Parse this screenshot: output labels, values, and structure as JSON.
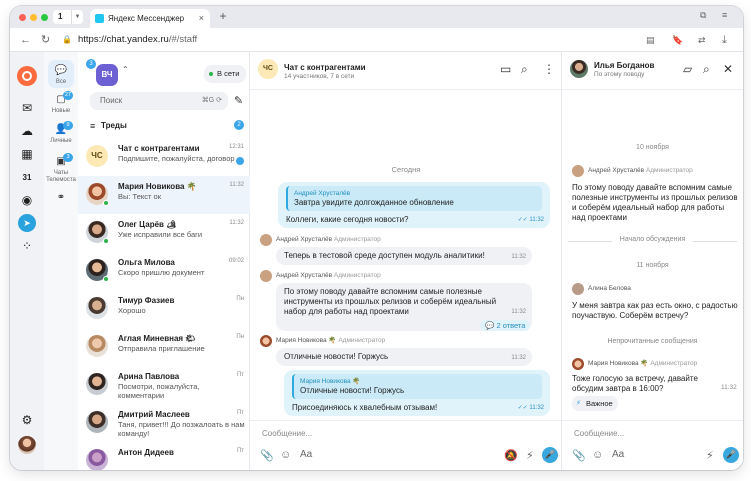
{
  "browser": {
    "tab_count": "1",
    "tab_title": "Яндекс Мессенджер",
    "url_host": "https://chat.yandex.ru",
    "url_path": "/#/staff"
  },
  "categories": [
    {
      "label": "Все",
      "badge": "27"
    },
    {
      "label": "Новые",
      "badge": ""
    },
    {
      "label": "Личные",
      "badge": "9"
    },
    {
      "label": "Чаты Телемоста",
      "badge": "3"
    }
  ],
  "workspace": {
    "initials": "ВЧ",
    "badge": "3",
    "status": "В сети"
  },
  "search": {
    "placeholder": "Поиск",
    "hotkey": "⌘G"
  },
  "threads": {
    "label": "Треды",
    "badge": "2"
  },
  "chats": [
    {
      "initials": "ЧС",
      "name": "Чат с контрагентами",
      "preview": "Подпишите, пожалуйста, договор",
      "time": "12:31"
    },
    {
      "name": "Мария Новикова 🌴",
      "preview": "Вы: Текст ок",
      "time": "11:32"
    },
    {
      "name": "Олег Царёв 🏕",
      "preview": "Уже исправили все баги",
      "time": "11:32"
    },
    {
      "name": "Ольга Милова",
      "preview": "Скоро пришлю документ",
      "time": "09:02"
    },
    {
      "name": "Тимур Фазиев",
      "preview": "Хорошо",
      "time": "Пн"
    },
    {
      "name": "Аглая Миневная 🌤",
      "preview": "Отправила приглашение",
      "time": "Пн"
    },
    {
      "name": "Арина Павлова",
      "preview": "Посмотри, пожалуйста, комментарии",
      "time": "Пт"
    },
    {
      "name": "Дмитрий Маслеев",
      "preview": "Таня, привет!!! До позжалоать в нам команду!",
      "time": "Пт"
    },
    {
      "name": "Антон Дидеев",
      "preview": "",
      "time": "Пт"
    }
  ],
  "chat": {
    "initials": "ЧС",
    "title": "Чат с контрагентами",
    "subtitle": "14 участников, 7 в сети",
    "day": "Сегодня",
    "input_placeholder": "Сообщение...",
    "m1": {
      "quote_author": "Андрей Хрусталёв",
      "quote_text": "Завтра увидите долгожданное обновление",
      "text": "Коллеги, какие сегодня новости?",
      "time": "11:32"
    },
    "m2": {
      "author": "Андрей Хрусталёв",
      "role": "Администратор",
      "text": "Теперь в тестовой среде доступен модуль аналитики!",
      "time": "11:32"
    },
    "m3": {
      "author": "Андрей Хрусталёв",
      "role": "Администратор",
      "text": "По этому поводу давайте вспомним самые полезные инструменты из прошлых релизов и соберём идеальный набор для работы над проектами",
      "time": "11:32",
      "replies": "2 ответа"
    },
    "m4": {
      "author": "Мария Новикова 🌴",
      "role": "Администратор",
      "text": "Отличные новости! Горжусь",
      "time": "11:32"
    },
    "m5": {
      "quote_author": "Мария Новикова 🌴",
      "quote_text": "Отличные новости! Горжусь",
      "text": "Присоединяюсь к хвалебным отзывам!",
      "time": "11:32"
    }
  },
  "thread": {
    "name": "Илья Богданов",
    "subtitle": "По этому поводу",
    "date1": "10 ноября",
    "t1": {
      "author": "Андрей Хрусталёв",
      "role": "Администратор",
      "text": "По этому поводу давайте вспомним самые полезные инструменты из прошлых релизов и соберём идеальный набор для работы над проектами"
    },
    "discussion": "Начало обсуждения",
    "date2": "11 ноября",
    "t2": {
      "author": "Алина Белова",
      "text": "У меня завтра как раз есть окно, с радостью поучаствую. Соберём встречу?"
    },
    "unread": "Непрочитанные сообщения",
    "t3": {
      "author": "Мария Новикова 🌴",
      "role": "Администратор",
      "text": "Тоже голосую за встречу, давайте обсудим завтра в 16:00?",
      "time": "11:32",
      "tag": "Важное"
    },
    "input_placeholder": "Сообщение..."
  }
}
